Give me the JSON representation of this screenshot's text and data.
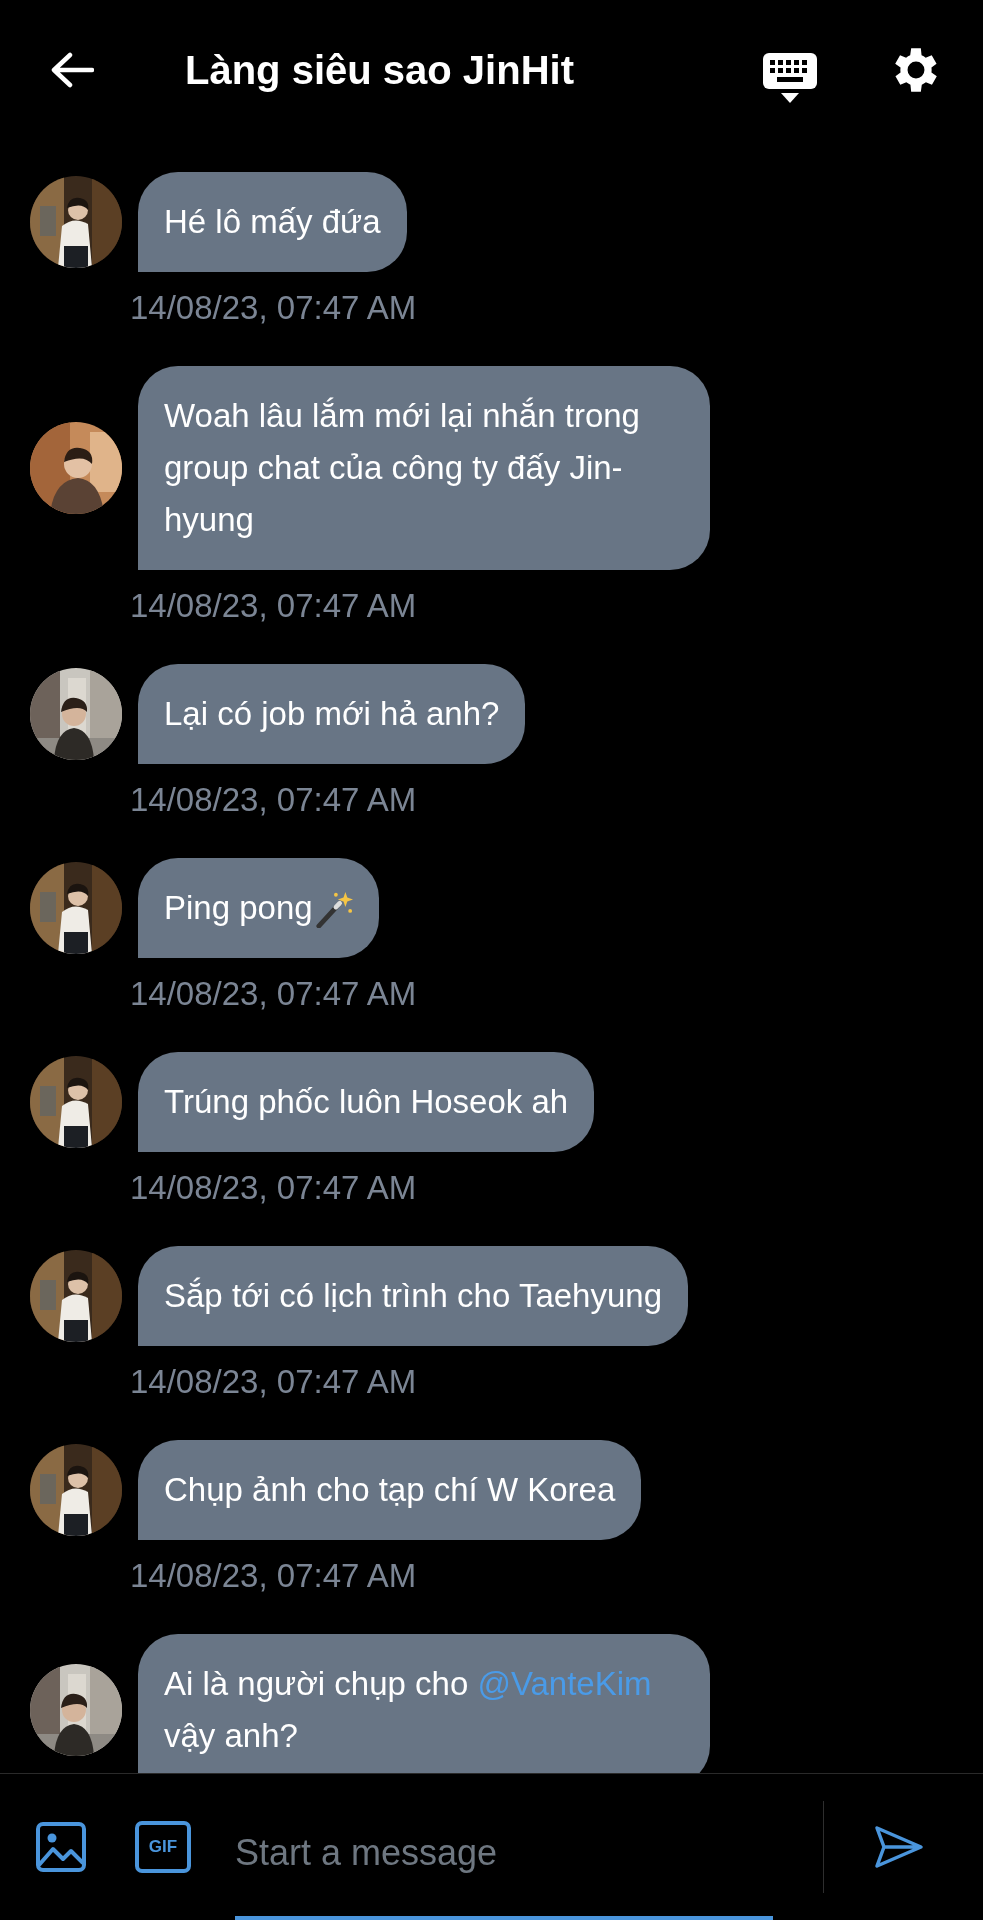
{
  "header": {
    "title": "Làng siêu sao JinHit"
  },
  "messages": [
    {
      "text": "Hé lô mấy đứa",
      "time": "14/08/23, 07:47 AM"
    },
    {
      "text": "Woah lâu lắm mới lại nhắn trong group chat của công ty đấy Jin-hyung",
      "time": "14/08/23, 07:47 AM"
    },
    {
      "text": "Lại có job mới hả anh?",
      "time": "14/08/23, 07:47 AM"
    },
    {
      "text": "Ping pong",
      "trailing_icon": true,
      "time": "14/08/23, 07:47 AM"
    },
    {
      "text": "Trúng phốc luôn Hoseok ah",
      "time": "14/08/23, 07:47 AM"
    },
    {
      "text": "Sắp tới có lịch trình cho Taehyung",
      "time": "14/08/23, 07:47 AM"
    },
    {
      "text": "Chụp ảnh cho tạp chí W Korea",
      "time": "14/08/23, 07:47 AM"
    },
    {
      "parts": [
        {
          "kind": "text",
          "text": "Ai là người chụp cho "
        },
        {
          "kind": "mention",
          "text": "@VanteKim"
        },
        {
          "kind": "text",
          "text": " vậy anh?"
        }
      ]
    }
  ],
  "composer": {
    "gif_label": "GIF",
    "placeholder": "Start a message"
  }
}
